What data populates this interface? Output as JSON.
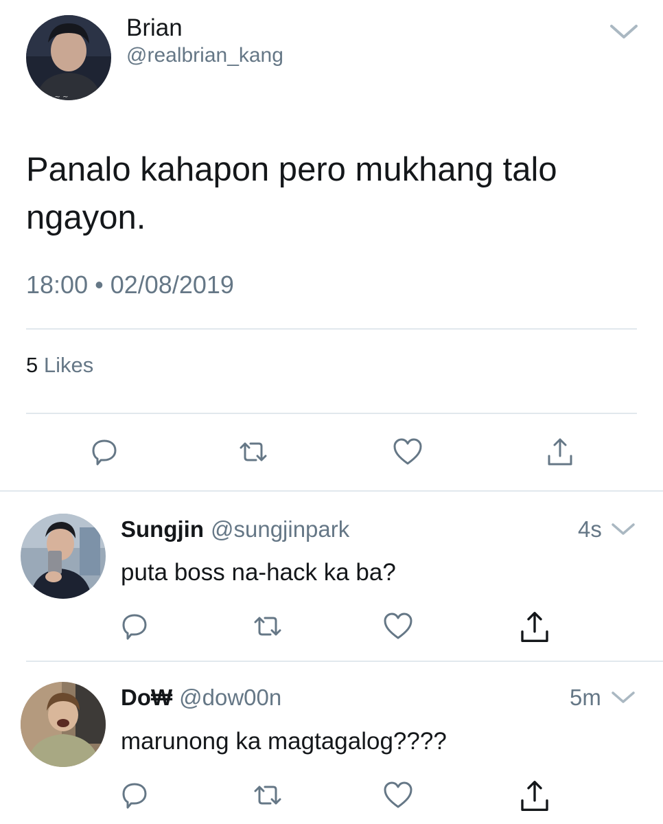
{
  "main_tweet": {
    "name": "Brian",
    "handle": "@realbrian_kang",
    "text": "Panalo kahapon pero mukhang talo ngayon.",
    "time": "18:00",
    "separator": "•",
    "date": "02/08/2019",
    "likes_count": "5",
    "likes_label": "Likes"
  },
  "replies": [
    {
      "name": "Sungjin",
      "handle": "@sungjinpark",
      "time": "4s",
      "text": "puta boss na-hack ka ba?"
    },
    {
      "name": "Do₩",
      "handle": "@dow00n",
      "time": "5m",
      "text": "marunong ka magtagalog????"
    }
  ],
  "icons": [
    "chevron-down-icon",
    "reply-icon",
    "retweet-icon",
    "heart-icon",
    "share-icon"
  ],
  "colors": {
    "text": "#14171a",
    "secondary": "#657786",
    "divider": "#e1e8ed",
    "icon": "#657786"
  }
}
